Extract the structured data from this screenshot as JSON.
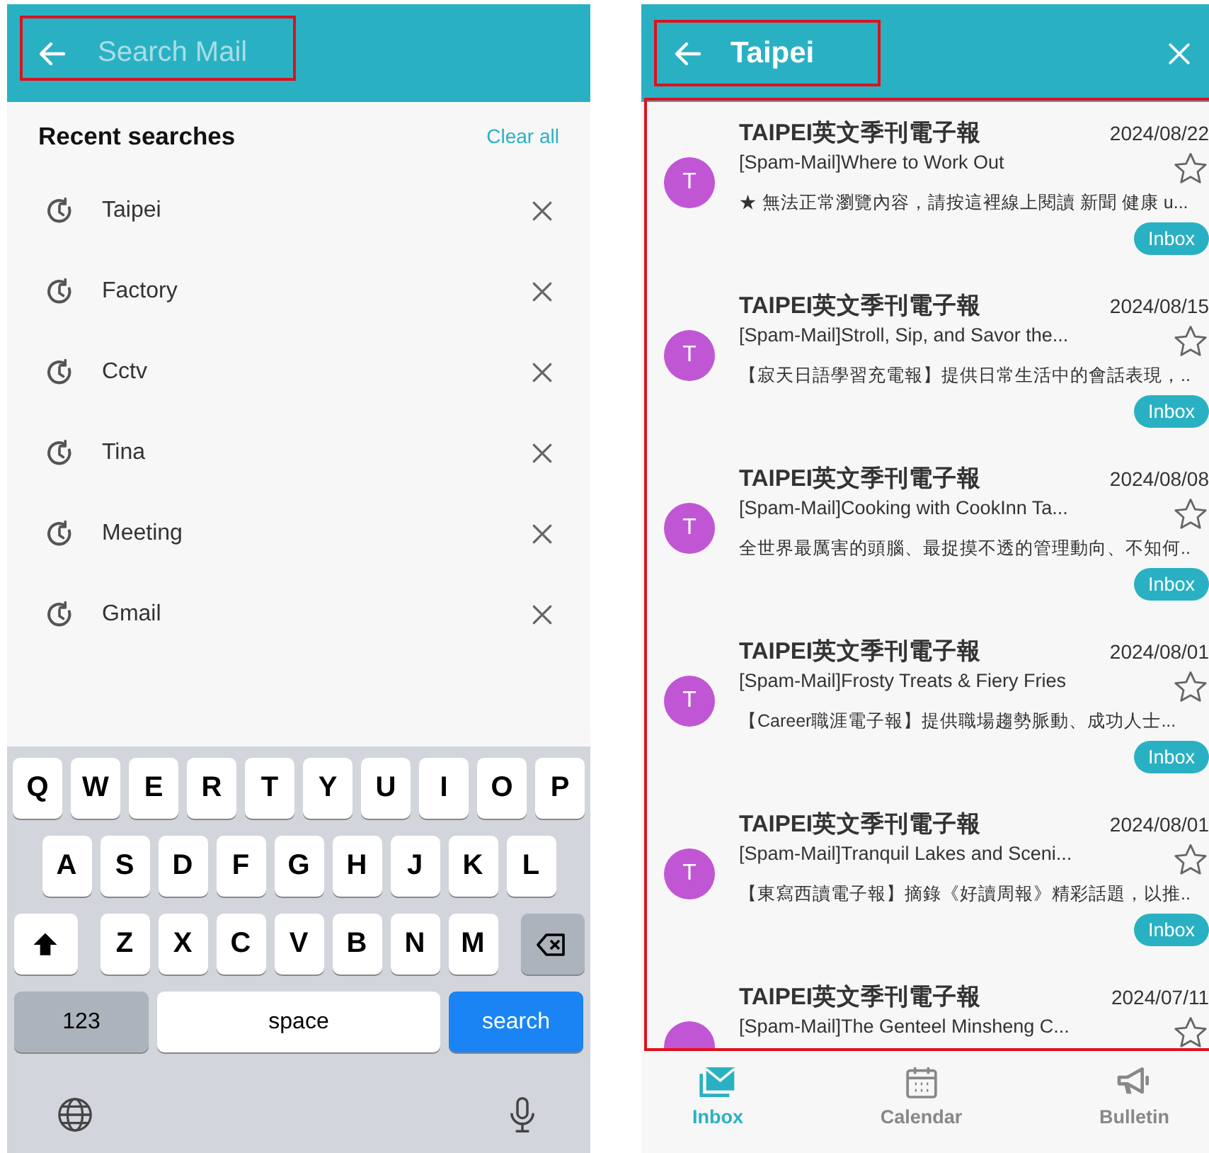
{
  "search_screen": {
    "search_field": {
      "placeholder": "Search Mail"
    },
    "recent_title": "Recent searches",
    "clear_all": "Clear all",
    "recent": [
      "Taipei",
      "Factory",
      "Cctv",
      "Tina",
      "Meeting",
      "Gmail"
    ],
    "keyboard": {
      "rows": [
        [
          "Q",
          "W",
          "E",
          "R",
          "T",
          "Y",
          "U",
          "I",
          "O",
          "P"
        ],
        [
          "A",
          "S",
          "D",
          "F",
          "G",
          "H",
          "J",
          "K",
          "L"
        ],
        [
          "Z",
          "X",
          "C",
          "V",
          "B",
          "N",
          "M"
        ]
      ],
      "numbers_key": "123",
      "space_key": "space",
      "search_key": "search"
    }
  },
  "results_screen": {
    "query": "Taipei",
    "emails": [
      {
        "avatar": "T",
        "sender": "TAIPEI英文季刊電子報",
        "date": "2024/08/22",
        "subject": "[Spam-Mail]Where to Work Out",
        "preview": "★ 無法正常瀏覽內容，請按這裡線上閱讀 新聞 健康 u...",
        "folder": "Inbox",
        "starred": false
      },
      {
        "avatar": "T",
        "sender": "TAIPEI英文季刊電子報",
        "date": "2024/08/15",
        "subject": "[Spam-Mail]Stroll, Sip, and Savor the...",
        "preview": "【寂天日語學習充電報】提供日常生活中的會話表現，..",
        "folder": "Inbox",
        "starred": false
      },
      {
        "avatar": "T",
        "sender": "TAIPEI英文季刊電子報",
        "date": "2024/08/08",
        "subject": "[Spam-Mail]Cooking with CookInn Ta...",
        "preview": "全世界最厲害的頭腦、最捉摸不透的管理動向、不知何..",
        "folder": "Inbox",
        "starred": false
      },
      {
        "avatar": "T",
        "sender": "TAIPEI英文季刊電子報",
        "date": "2024/08/01",
        "subject": "[Spam-Mail]Frosty Treats & Fiery Fries",
        "preview": "【Career職涯電子報】提供職場趨勢脈動、成功人士...",
        "folder": "Inbox",
        "starred": false
      },
      {
        "avatar": "T",
        "sender": "TAIPEI英文季刊電子報",
        "date": "2024/08/01",
        "subject": "[Spam-Mail]Tranquil Lakes and Sceni...",
        "preview": "【東寫西讀電子報】摘錄《好讀周報》精彩話題，以推..",
        "folder": "Inbox",
        "starred": false
      },
      {
        "sender": "TAIPEI英文季刊電子報",
        "date": "2024/07/11",
        "subject": "[Spam-Mail]The Genteel Minsheng C...",
        "starred": false
      }
    ],
    "bottom_nav": [
      {
        "label": "Inbox",
        "kind": "mail",
        "selected": true
      },
      {
        "label": "Calendar",
        "kind": "calendar",
        "selected": false
      },
      {
        "label": "Bulletin",
        "kind": "megaphone",
        "selected": false
      }
    ]
  }
}
